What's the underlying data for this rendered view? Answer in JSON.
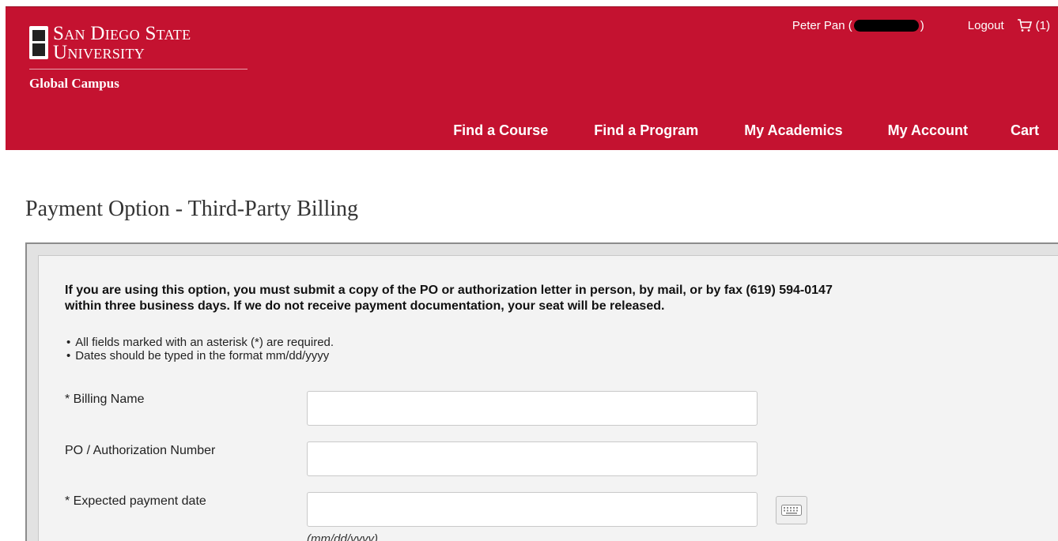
{
  "header": {
    "logo_line1": "San Diego State",
    "logo_line2": "University",
    "logo_sub": "Global Campus",
    "user_prefix": "Peter Pan (",
    "user_suffix": ")",
    "logout": "Logout",
    "cart_count": "(1)",
    "brand_color": "#c41230"
  },
  "nav": {
    "items": [
      "Find a Course",
      "Find a Program",
      "My Academics",
      "My Account",
      "Cart"
    ]
  },
  "page": {
    "title": "Payment Option - Third-Party Billing"
  },
  "form": {
    "notice_line1": "If you are using this option, you must submit a copy of the PO or authorization letter in person, by mail, or by fax (619) 594-0147",
    "notice_line2": "within three business days. If we do not receive payment documentation, your seat will be released.",
    "bullets": [
      "All fields marked with an asterisk (*) are required.",
      "Dates should be typed in the format mm/dd/yyyy"
    ],
    "fields": [
      {
        "label": "* Billing Name",
        "value": ""
      },
      {
        "label": "PO / Authorization Number",
        "value": ""
      },
      {
        "label": "* Expected payment date",
        "value": ""
      }
    ],
    "date_hint": "(mm/dd/yyyy)"
  },
  "icons": {
    "cart": "cart-icon",
    "keyboard": "keyboard-icon"
  }
}
